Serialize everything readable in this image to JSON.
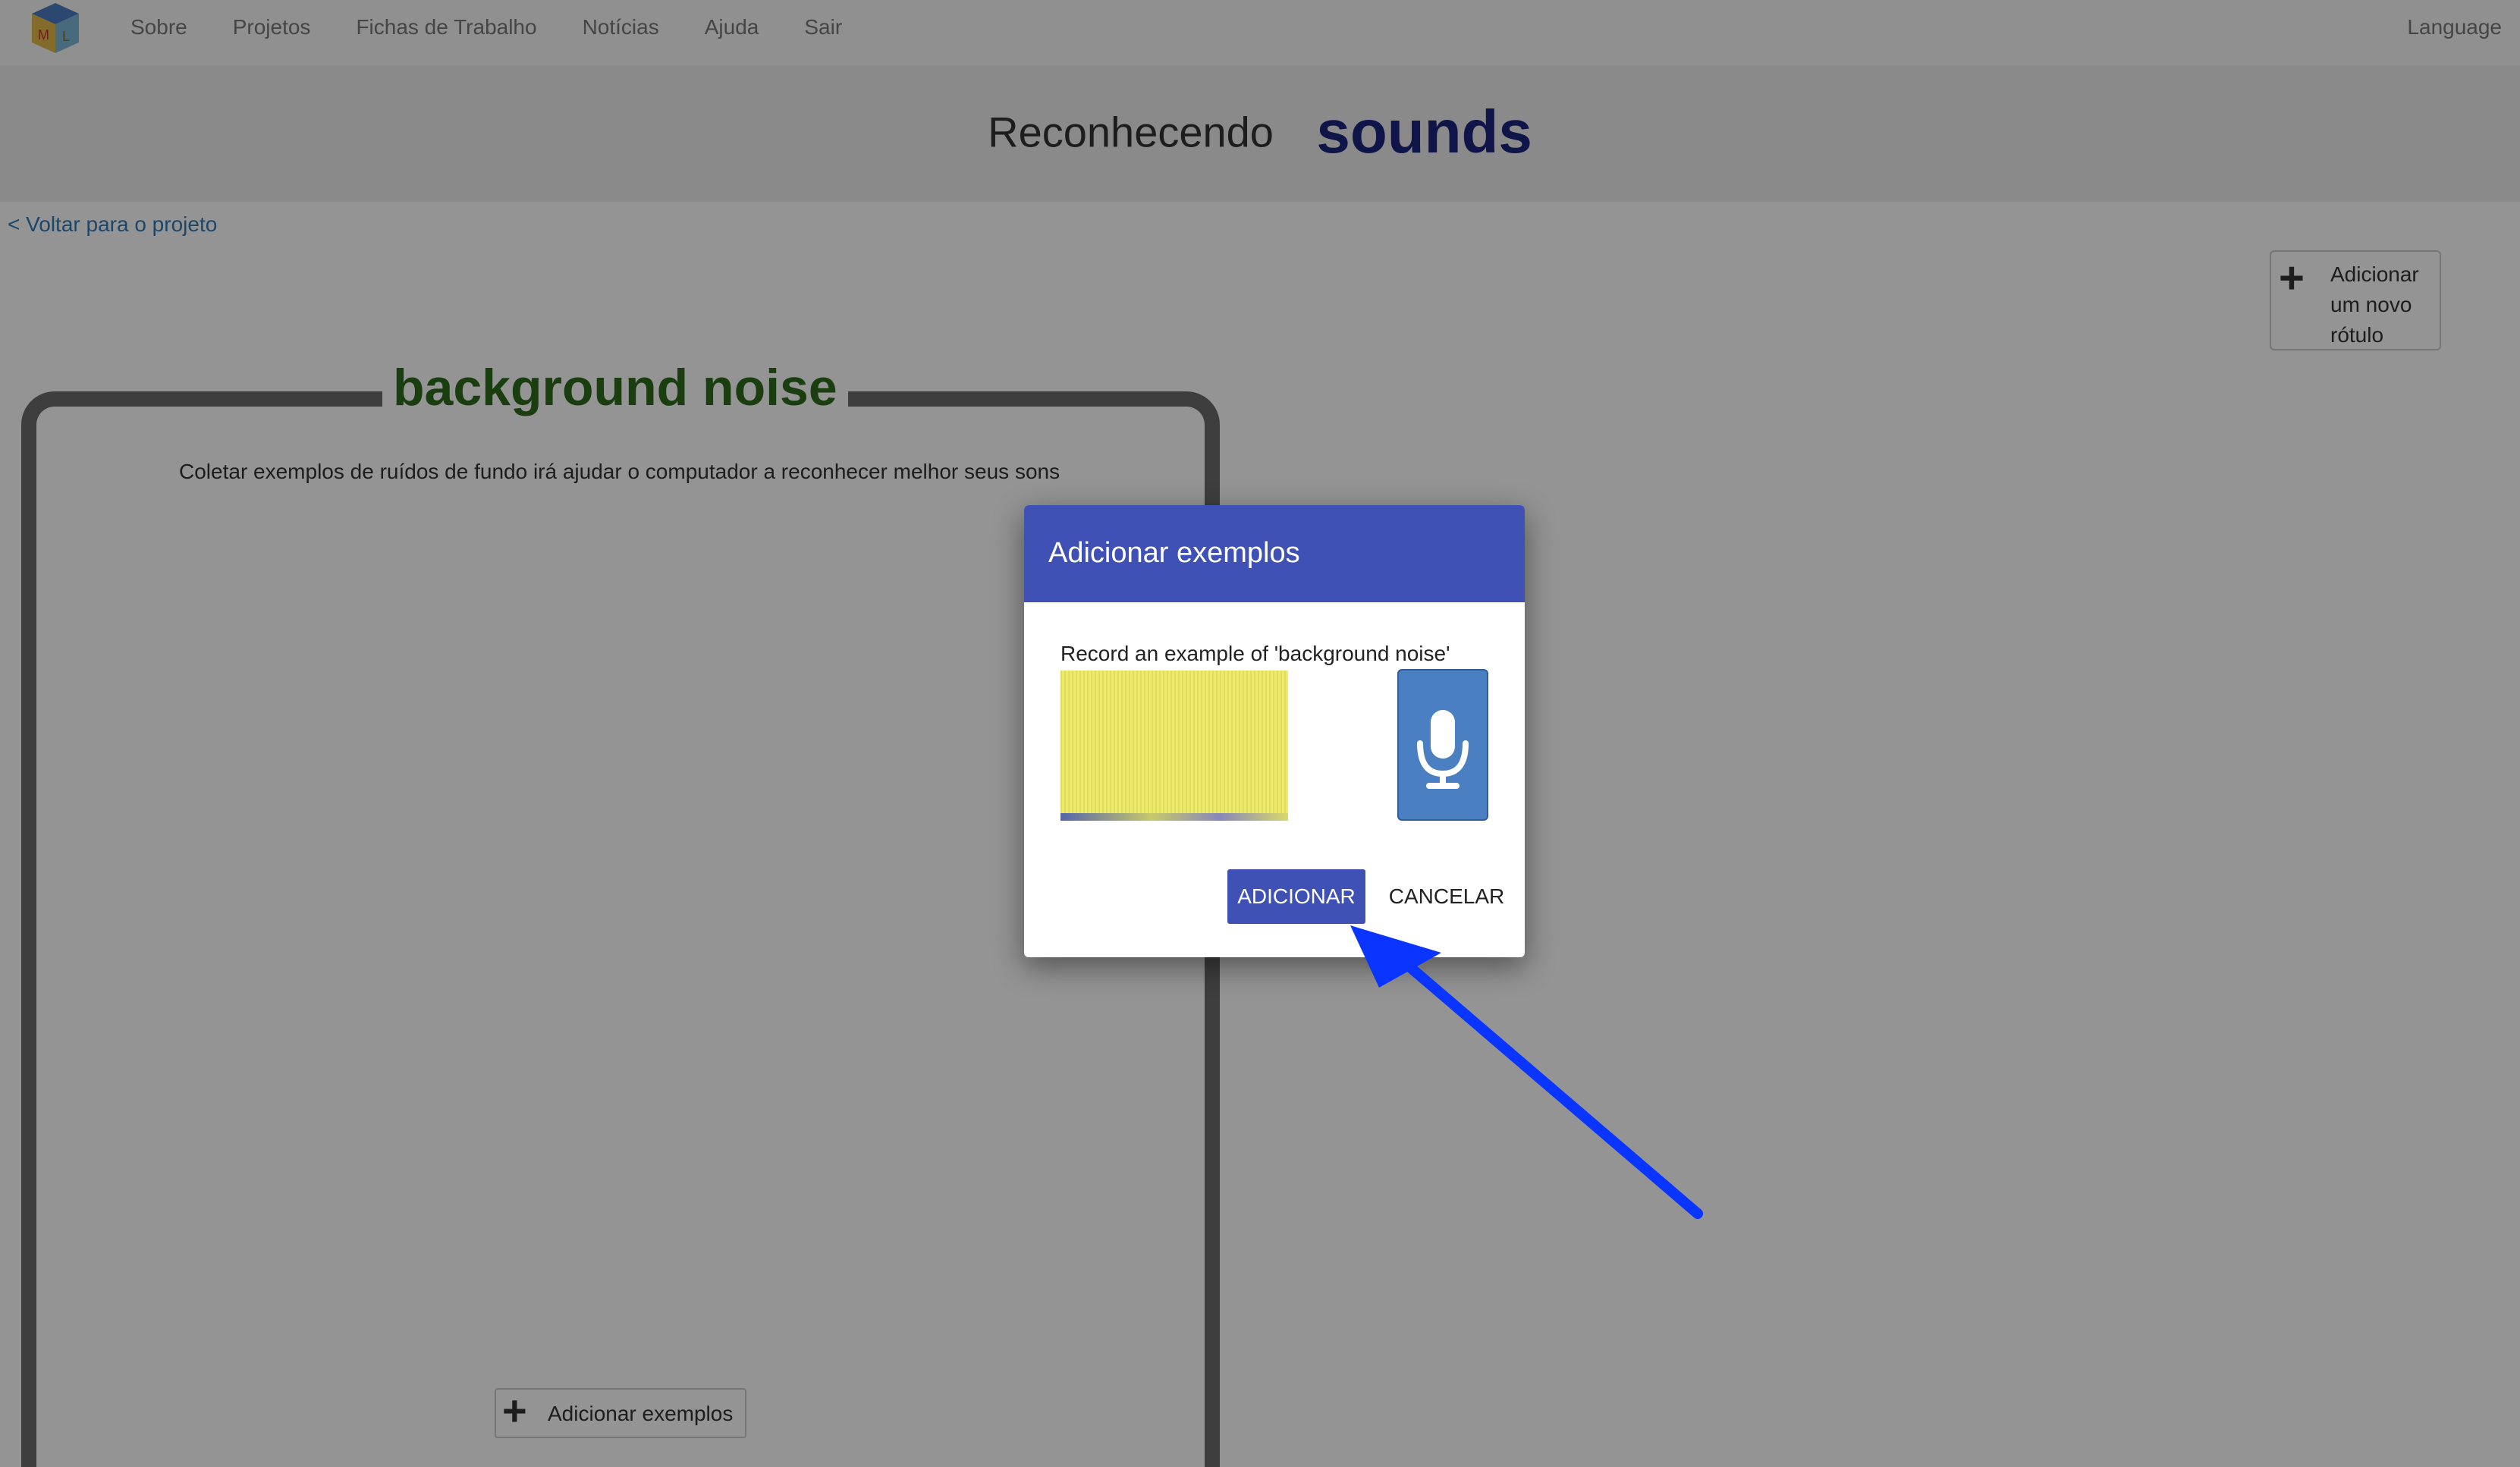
{
  "nav": {
    "items": [
      "Sobre",
      "Projetos",
      "Fichas de Trabalho",
      "Notícias",
      "Ajuda",
      "Sair"
    ],
    "language": "Language"
  },
  "header": {
    "prefix": "Reconhecendo",
    "model_name": "sounds"
  },
  "back_link": "< Voltar para o projeto",
  "add_label_button": "Adicionar\num novo\nrótulo",
  "label_card": {
    "title": "background noise",
    "description": "Coletar exemplos de ruídos de fundo irá ajudar o computador a reconhecer melhor seus sons",
    "add_examples_button": "Adicionar exemplos"
  },
  "dialog": {
    "title": "Adicionar exemplos",
    "prompt": "Record an example of 'background noise'",
    "add_button": "ADICIONAR",
    "cancel_button": "CANCELAR"
  },
  "colors": {
    "primary": "#3f51b5",
    "model_name": "#1a237e",
    "label_title": "#2e6b1a",
    "mic_button": "#4a7fc1",
    "arrow": "#0a35ff"
  },
  "icons": [
    "ml-logo-icon",
    "plus-icon",
    "microphone-icon",
    "arrow-annotation"
  ]
}
